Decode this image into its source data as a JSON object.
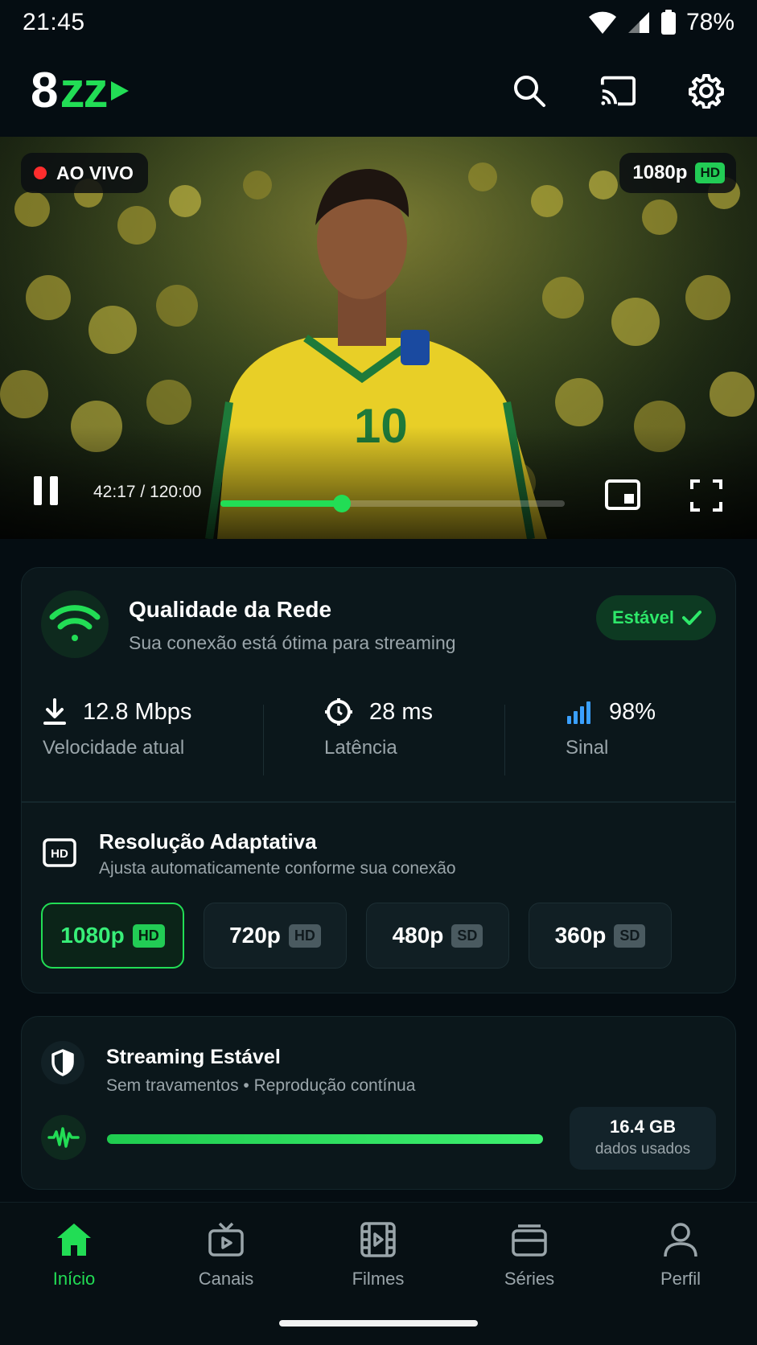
{
  "status_bar": {
    "time": "21:45",
    "battery": "78%"
  },
  "header": {
    "logo_main": "8",
    "logo_accent": "zz"
  },
  "video": {
    "live_label": "AO VIVO",
    "resolution_label": "1080p",
    "resolution_tag": "HD",
    "time_display": "42:17 / 120:00",
    "progress": 0.352
  },
  "network": {
    "title": "Qualidade da Rede",
    "subtitle": "Sua conexão está ótima para streaming",
    "status": "Estável",
    "stats": [
      {
        "value": "12.8 Mbps",
        "label": "Velocidade atual",
        "icon": "download-icon"
      },
      {
        "value": "28 ms",
        "label": "Latência",
        "icon": "latency-icon"
      },
      {
        "value": "98%",
        "label": "Sinal",
        "icon": "signal-bars-icon"
      }
    ]
  },
  "resolution": {
    "title": "Resolução Adaptativa",
    "subtitle": "Ajusta automaticamente conforme sua conexão",
    "options": [
      {
        "label": "1080p",
        "tag": "HD",
        "active": true
      },
      {
        "label": "720p",
        "tag": "HD",
        "active": false
      },
      {
        "label": "480p",
        "tag": "SD",
        "active": false
      },
      {
        "label": "360p",
        "tag": "SD",
        "active": false
      }
    ]
  },
  "stream": {
    "title": "Streaming Estável",
    "subtitle": "Sem travamentos • Reprodução contínua",
    "data_value": "16.4 GB",
    "data_label": "dados usados",
    "bar_fill": 1.0
  },
  "nav": [
    {
      "label": "Início",
      "icon": "home-icon",
      "active": true
    },
    {
      "label": "Canais",
      "icon": "tv-icon",
      "active": false
    },
    {
      "label": "Filmes",
      "icon": "film-icon",
      "active": false
    },
    {
      "label": "Séries",
      "icon": "series-icon",
      "active": false
    },
    {
      "label": "Perfil",
      "icon": "profile-icon",
      "active": false
    }
  ],
  "colors": {
    "accent": "#22dd55",
    "background": "#050d12",
    "card": "#0b171b",
    "live": "#ff2d2d"
  }
}
